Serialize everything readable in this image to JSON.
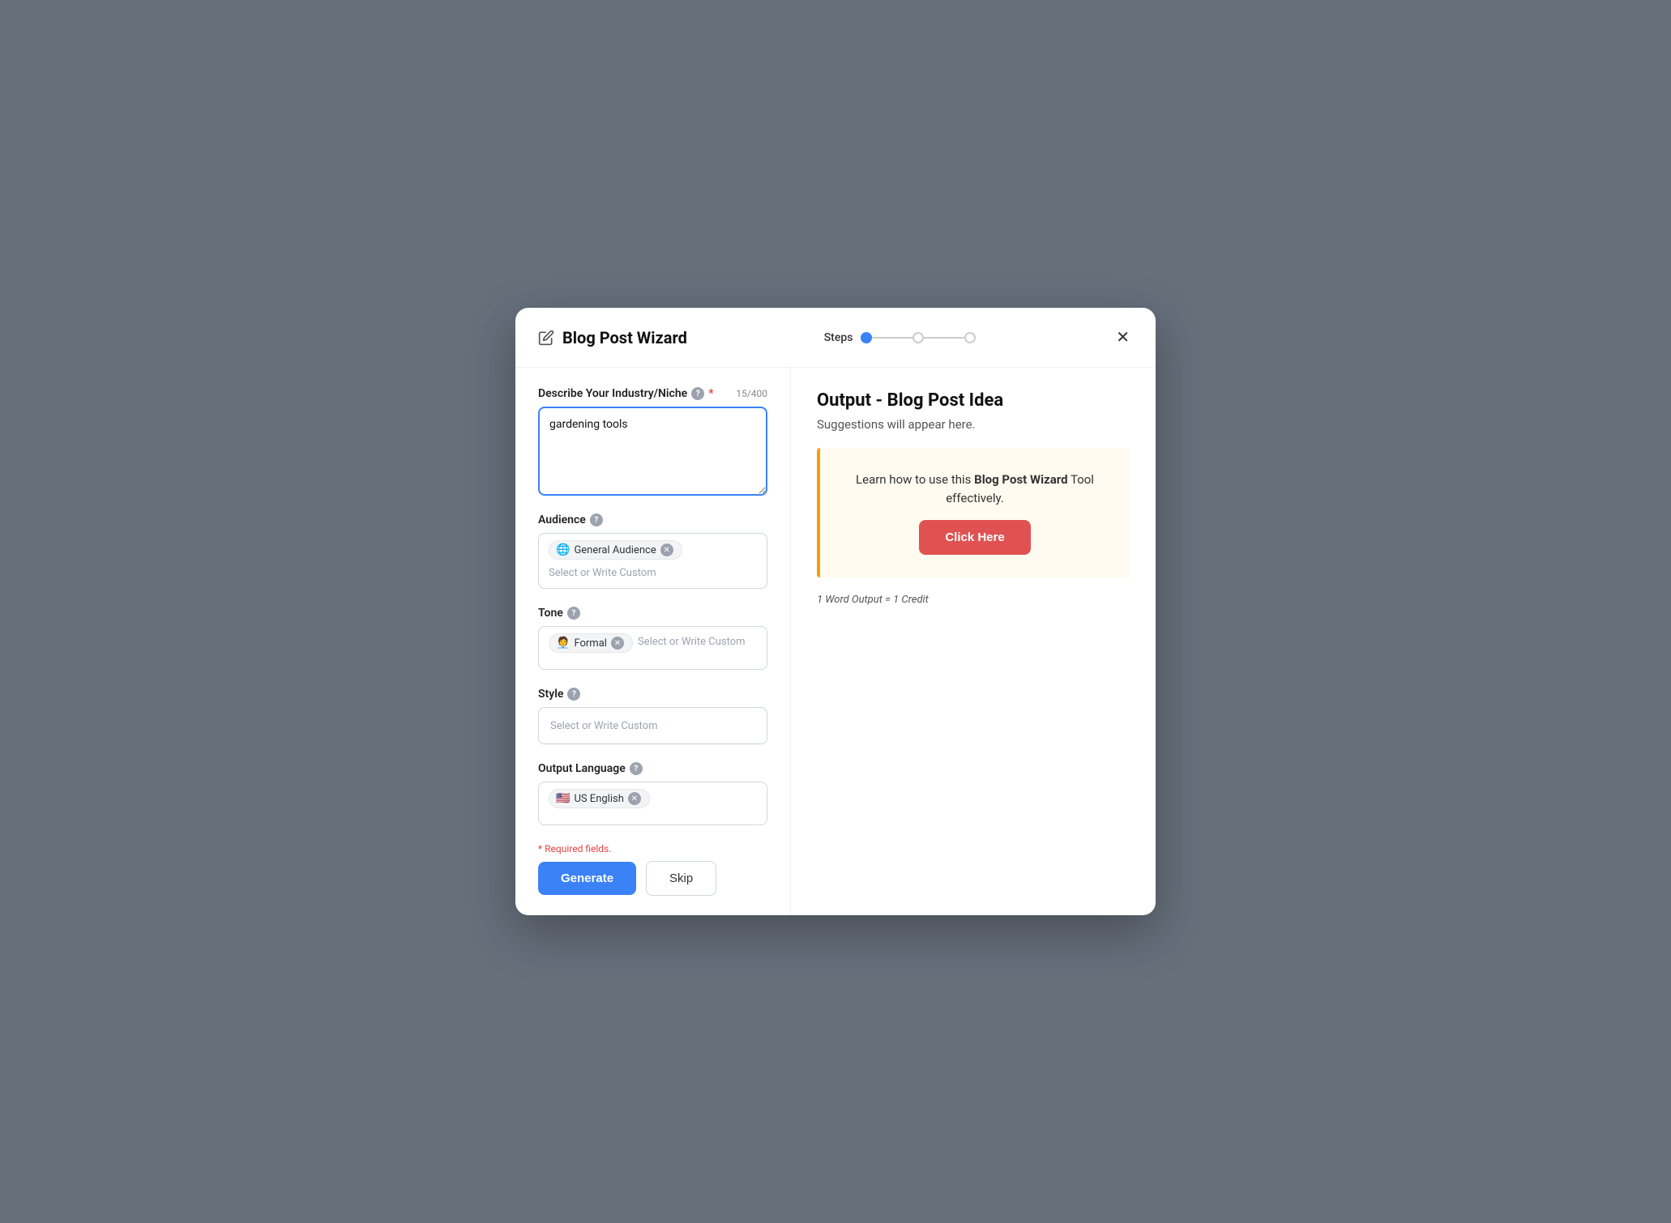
{
  "modal": {
    "title": "Blog Post Wizard",
    "steps_label": "Steps",
    "steps": [
      {
        "active": true
      },
      {
        "active": false
      },
      {
        "active": false
      }
    ]
  },
  "left": {
    "industry_label": "Describe Your Industry/Niche",
    "industry_char_count": "15/400",
    "industry_value": "gardening tools",
    "industry_placeholder": "gardening tools",
    "audience_label": "Audience",
    "audience_tag_emoji": "🌐",
    "audience_tag_text": "General Audience",
    "audience_placeholder": "Select or Write Custom",
    "tone_label": "Tone",
    "tone_tag_emoji": "🧑‍💼",
    "tone_tag_text": "Formal",
    "tone_placeholder": "Select or Write Custom",
    "style_label": "Style",
    "style_placeholder": "Select or Write Custom",
    "language_label": "Output Language",
    "language_tag_emoji": "🇺🇸",
    "language_tag_text": "US English",
    "required_note": "* Required fields.",
    "generate_label": "Generate",
    "skip_label": "Skip"
  },
  "right": {
    "output_title": "Output - Blog Post Idea",
    "output_subtitle": "Suggestions will appear here.",
    "promo_text_before": "Learn how to use this ",
    "promo_bold": "Blog Post Wizard",
    "promo_text_after": " Tool effectively.",
    "click_here_label": "Click Here",
    "credit_note": "1 Word Output = 1 Credit"
  }
}
